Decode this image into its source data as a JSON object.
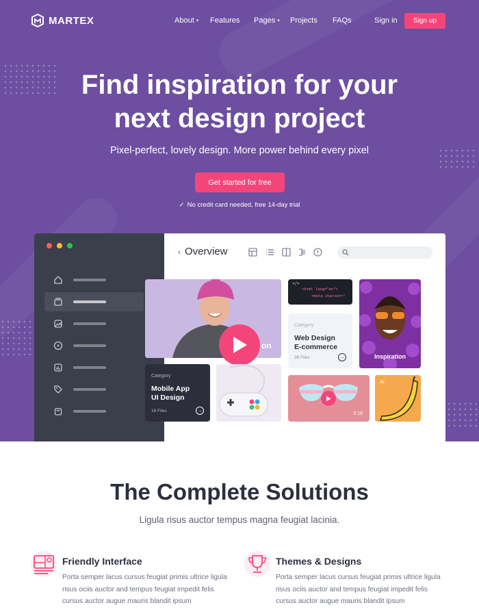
{
  "brand": {
    "name": "MARTEX"
  },
  "nav": {
    "items": [
      {
        "label": "About"
      },
      {
        "label": "Features"
      },
      {
        "label": "Pages"
      },
      {
        "label": "Projects"
      },
      {
        "label": "FAQs"
      }
    ],
    "signin": "Sign in",
    "signup": "Sign up"
  },
  "hero": {
    "title_line1": "Find inspiration for your",
    "title_line2": "next design project",
    "subtitle": "Pixel-perfect, lovely design. More power behind every pixel",
    "cta": "Get started for free",
    "trial": "No credit card needed, free 14-day trial"
  },
  "mockup": {
    "header": "Overview",
    "sidebar_icons": [
      "home-icon",
      "archive-icon",
      "image-icon",
      "play-icon",
      "chart-icon",
      "tag-icon",
      "bag-icon"
    ],
    "code_line1": "<html lang=\"en\">",
    "code_line2": "<meta charset=\"",
    "cards": {
      "web": {
        "category": "Category",
        "title_l1": "Web Design",
        "title_l2": "E-commerce",
        "files": "26 Files"
      },
      "mobile": {
        "category": "Category",
        "title_l1": "Mobile App",
        "title_l2": "UI Design",
        "files": "18 Files"
      },
      "inspiration": "Inspiration",
      "photo_partial": "on",
      "video_time": "0:16",
      "ai_label": "Ai"
    }
  },
  "solutions": {
    "title": "The Complete Solutions",
    "subtitle": "Ligula risus auctor tempus magna feugiat lacinia.",
    "features": [
      {
        "title": "Friendly Interface",
        "text": "Porta semper lacus cursus feugiat primis ultrice ligula risus ociis auctor and tempus feugiat impedit felis cursus auctor augue mauris blandit ipsum"
      },
      {
        "title": "Themes & Designs",
        "text": "Porta semper lacus cursus feugiat primis ultrice ligula risus ociis auctor and tempus feugiat impedit felis cursus auctor augue mauris blandit ipsum"
      }
    ]
  },
  "colors": {
    "hero_bg": "#6d4ea0",
    "accent": "#f4457a",
    "sidebar": "#3b3f4b"
  }
}
